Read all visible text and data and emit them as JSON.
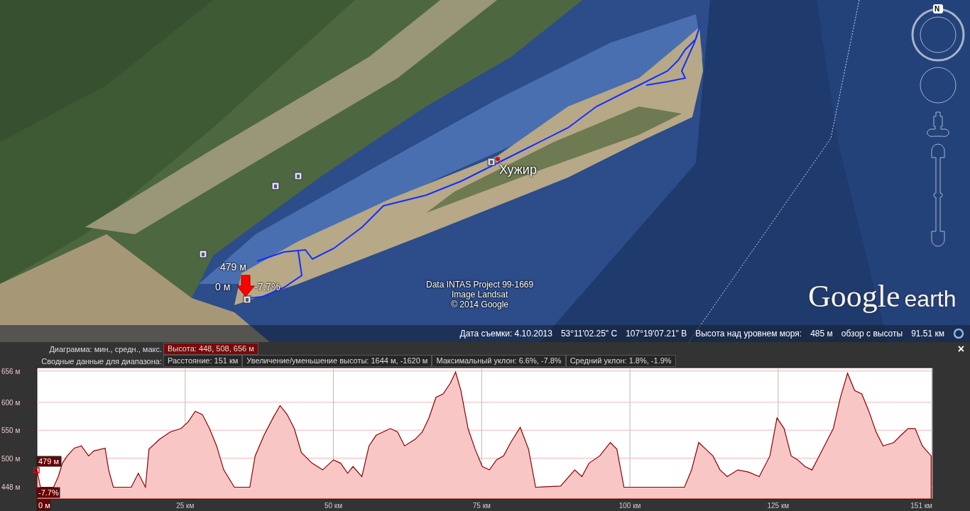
{
  "map": {
    "place_label": "Хужир",
    "track_labels": {
      "elevation": "479 м",
      "distance": "0 м",
      "slope": "-7.7%"
    },
    "attribution": [
      "Data INTAS Project 99-1669",
      "Image Landsat",
      "© 2014 Google"
    ],
    "logo": {
      "name": "Google",
      "suffix": "earth"
    },
    "compass": {
      "north": "N"
    }
  },
  "status_bar": [
    "Дата съемки: 4.10.2013",
    "53°11'02.25\" С",
    "107°19'07.21\" В",
    "Высота над уровнем моря:",
    "485 м",
    "обзор с высоты",
    "91.51 км"
  ],
  "profile": {
    "rows": [
      {
        "label": "Диаграмма: мин., средн., макс.",
        "cells": [
          {
            "text": "Высота: 448, 508, 656 м",
            "kind": "highlight"
          }
        ]
      },
      {
        "label": "Сводные данные для диапазона:",
        "cells": [
          {
            "text": "Расстояние: 151 км",
            "kind": "plain"
          },
          {
            "text": "Увеличение/уменьшение высоты: 1644 м, -1620 м",
            "kind": "plain"
          },
          {
            "text": "Максимальный уклон: 6.6%, -7.8%",
            "kind": "plain"
          },
          {
            "text": "Средний уклон: 1.8%, -1.9%",
            "kind": "plain"
          }
        ]
      }
    ],
    "close": "×",
    "markers": {
      "elevation": "479 м",
      "slope": "-7.7%",
      "distance": "0 м"
    },
    "chart_data": {
      "type": "area",
      "x": [
        0,
        0.6,
        2.8,
        3.6,
        4.3,
        5.1,
        6.3,
        7.5,
        8.7,
        9.6,
        11.5,
        12.1,
        12.9,
        15.9,
        17.1,
        18.3,
        18.9,
        20.7,
        22.5,
        24.3,
        25.5,
        26.7,
        27.9,
        29.1,
        30.3,
        31.5,
        33.3,
        35.9,
        36.8,
        38.3,
        39.8,
        41.0,
        42.2,
        43.4,
        44.6,
        46.4,
        48.2,
        49.4,
        50.0,
        51.2,
        52.4,
        53.3,
        54.8,
        56.0,
        57.2,
        58.4,
        59.6,
        60.8,
        62.0,
        63.8,
        65.0,
        66.1,
        67.3,
        68.5,
        69.7,
        70.6,
        71.5,
        72.7,
        73.9,
        75.1,
        76.3,
        77.5,
        78.7,
        79.9,
        81.5,
        82.9,
        84.1,
        88.3,
        90.7,
        91.9,
        93.1,
        94.9,
        96.7,
        97.8,
        99.0,
        109.2,
        110.4,
        111.6,
        112.8,
        114.0,
        115.2,
        116.4,
        118.2,
        120.0,
        121.8,
        123.6,
        124.8,
        126.0,
        127.2,
        128.3,
        129.5,
        130.7,
        132.5,
        134.3,
        135.5,
        136.7,
        137.9,
        139.1,
        140.3,
        141.5,
        142.7,
        144.5,
        145.7,
        146.9,
        148.1,
        149.3,
        150.8
      ],
      "grid": true,
      "series": [
        {
          "color": "#8b0000",
          "values": [
            479,
            448,
            448,
            467,
            491,
            504,
            518,
            522,
            504,
            513,
            518,
            479,
            448,
            448,
            473,
            448,
            516,
            534,
            547,
            553,
            565,
            584,
            578,
            553,
            522,
            479,
            448,
            448,
            504,
            541,
            572,
            594,
            578,
            553,
            510,
            491,
            479,
            491,
            497,
            491,
            473,
            485,
            467,
            522,
            541,
            547,
            553,
            547,
            522,
            534,
            547,
            572,
            609,
            615,
            634,
            654,
            621,
            553,
            516,
            485,
            479,
            497,
            504,
            528,
            555,
            516,
            448,
            450,
            479,
            467,
            491,
            504,
            528,
            516,
            448,
            448,
            479,
            528,
            516,
            504,
            479,
            467,
            479,
            475,
            467,
            504,
            572,
            553,
            504,
            497,
            485,
            479,
            516,
            553,
            609,
            652,
            621,
            615,
            584,
            547,
            522,
            528,
            541,
            553,
            553,
            522,
            504
          ]
        }
      ],
      "xlim": [
        0,
        151
      ],
      "ylim": [
        427,
        662
      ],
      "xticks": [
        {
          "value": 25,
          "label": "25 км"
        },
        {
          "value": 50,
          "label": "50 км"
        },
        {
          "value": 75,
          "label": "75 км"
        },
        {
          "value": 100,
          "label": "100 км"
        },
        {
          "value": 125,
          "label": "125 км"
        },
        {
          "value": 151,
          "label": "151 км"
        }
      ],
      "yticks": [
        {
          "value": 448,
          "label": "448 м"
        },
        {
          "value": 500,
          "label": "500 м"
        },
        {
          "value": 550,
          "label": "550 м"
        },
        {
          "value": 600,
          "label": "600 м"
        },
        {
          "value": 656,
          "label": "656 м"
        }
      ]
    }
  }
}
